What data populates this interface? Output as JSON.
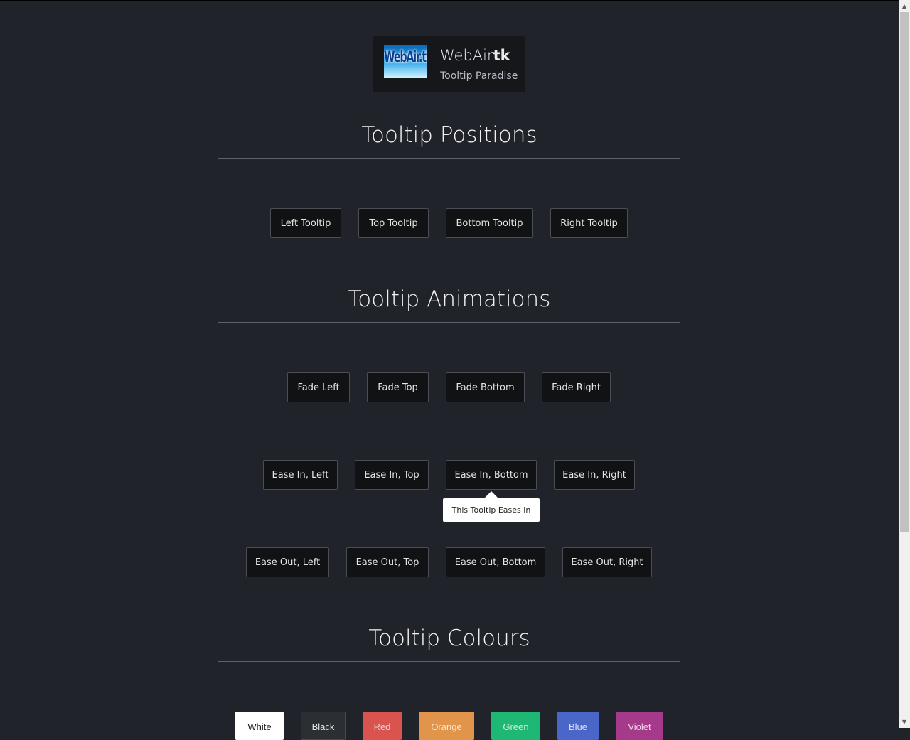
{
  "brand": {
    "name_light": "WebAir",
    "name_bold": "tk",
    "tagline": "Tooltip Paradise",
    "logo_text": "WebAir.tk"
  },
  "sections": {
    "positions": {
      "title": "Tooltip Positions",
      "buttons": [
        "Left Tooltip",
        "Top Tooltip",
        "Bottom Tooltip",
        "Right Tooltip"
      ]
    },
    "animations": {
      "title": "Tooltip Animations",
      "fade": [
        "Fade Left",
        "Fade Top",
        "Fade Bottom",
        "Fade Right"
      ],
      "ease_in": [
        "Ease In, Left",
        "Ease In, Top",
        "Ease In, Bottom",
        "Ease In, Right"
      ],
      "ease_out": [
        "Ease Out, Left",
        "Ease Out, Top",
        "Ease Out, Bottom",
        "Ease Out, Right"
      ]
    },
    "colours": {
      "title": "Tooltip Colours",
      "buttons": [
        {
          "label": "White",
          "bg": "#ffffff",
          "fg": "#222222"
        },
        {
          "label": "Black",
          "bg": "#2b2e33",
          "fg": "#e6e6e6"
        },
        {
          "label": "Red",
          "bg": "#d9534f",
          "fg": "#f5d0cf"
        },
        {
          "label": "Orange",
          "bg": "#e0954a",
          "fg": "#fbe7d2"
        },
        {
          "label": "Green",
          "bg": "#1eb874",
          "fg": "#c9f0df"
        },
        {
          "label": "Blue",
          "bg": "#4a66c9",
          "fg": "#d8dff5"
        },
        {
          "label": "Violet",
          "bg": "#a63a8a",
          "fg": "#f0d2e8"
        }
      ]
    }
  },
  "tooltip": {
    "text": "This Tooltip Eases in"
  }
}
